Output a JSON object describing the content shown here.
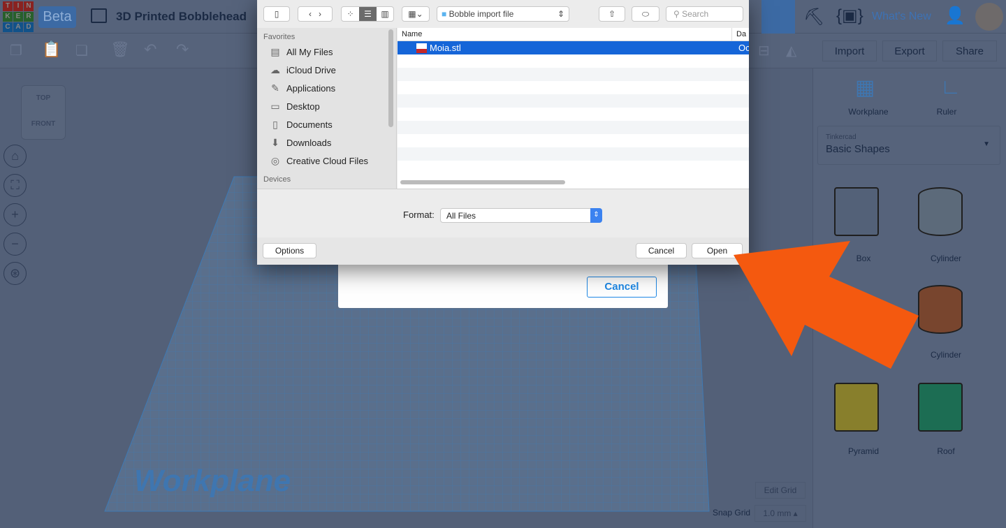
{
  "app": {
    "logo_letters": [
      "T",
      "I",
      "N",
      "K",
      "E",
      "R",
      "C",
      "A",
      "D"
    ],
    "logo_colors": [
      "#e53935",
      "#e53935",
      "#e53935",
      "#43a047",
      "#43a047",
      "#43a047",
      "#1e88e5",
      "#1e88e5",
      "#1e88e5"
    ],
    "beta": "Beta",
    "title": "3D Printed Bobblehead",
    "whats_new": "What's New",
    "actions": {
      "import": "Import",
      "export": "Export",
      "share": "Share"
    },
    "tools": {
      "workplane": "Workplane",
      "ruler": "Ruler"
    },
    "library": {
      "source": "Tinkercad",
      "category": "Basic Shapes"
    },
    "shapes": [
      {
        "label": "Box",
        "color": "#8aa2c8"
      },
      {
        "label": "Cylinder",
        "color": "#9ab0cc"
      },
      {
        "label": "Cylinder",
        "color": "#c8734d"
      },
      {
        "label": "Pyramid",
        "color": "#e2d44a"
      },
      {
        "label": "Roof",
        "color": "#2fb58a"
      }
    ],
    "viewcube": {
      "top": "TOP",
      "front": "FRONT"
    },
    "workplane_label": "Workplane",
    "edit_grid": "Edit Grid",
    "snap_grid_label": "Snap Grid",
    "snap_grid_value": "1.0 mm",
    "import_dialog_cancel": "Cancel"
  },
  "file_dialog": {
    "location": "Bobble import file",
    "search_placeholder": "Search",
    "favorites_header": "Favorites",
    "favorites": [
      "All My Files",
      "iCloud Drive",
      "Applications",
      "Desktop",
      "Documents",
      "Downloads",
      "Creative Cloud Files"
    ],
    "devices_header": "Devices",
    "columns": {
      "name": "Name",
      "date": "Da"
    },
    "files": [
      {
        "name": "Moia.stl",
        "date": "Oc",
        "selected": true
      }
    ],
    "format_label": "Format:",
    "format_value": "All Files",
    "options": "Options",
    "cancel": "Cancel",
    "open": "Open"
  },
  "annotation": {
    "arrow_color": "#f4590f"
  }
}
